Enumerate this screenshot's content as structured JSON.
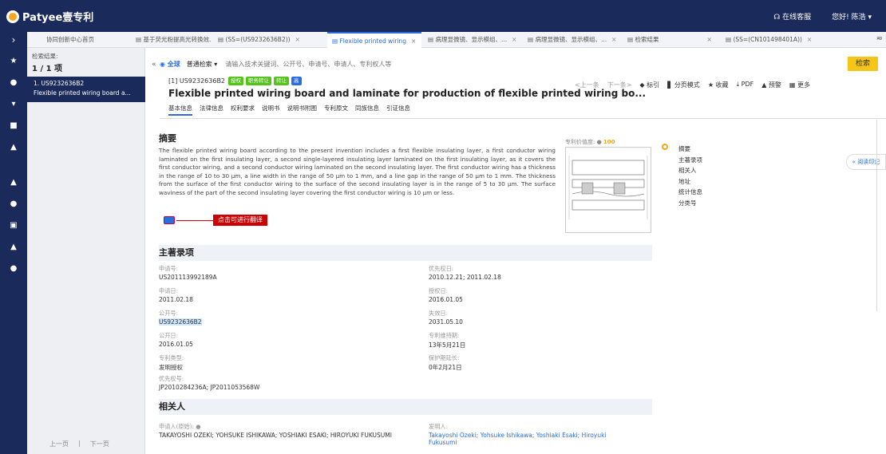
{
  "app": {
    "logo": "Patyee壹专利",
    "online_service": "在线客服",
    "greeting": "您好! 陈浩 ▾"
  },
  "tabs": [
    {
      "label": "协同创新中心首页"
    },
    {
      "label": "基于荧光粉提高光转换效..."
    },
    {
      "label": "(SS=(US9232636B2))"
    },
    {
      "label": "Flexible printed wiring"
    },
    {
      "label": "病理显微镜、显示模组、..."
    },
    {
      "label": "病理显微镜、显示模组、..."
    },
    {
      "label": "检索结果"
    },
    {
      "label": "(SS=(CN101498401A))"
    }
  ],
  "results": {
    "label": "检索结果:",
    "count": "1 / 1 项",
    "item_no": "1. US9232636B2",
    "item_title": "Flexible printed wiring board a...",
    "prev": "上一页",
    "sep": "|",
    "next": "下一页"
  },
  "search": {
    "scope": "全球",
    "type": "普通检索 ▾",
    "placeholder": "请输入技术关键词、公开号、申请号、申请人、专利权人等",
    "button": "检索"
  },
  "patent": {
    "num": "[1] US9232636B2",
    "badges": [
      {
        "text": "授权",
        "color": "#52c41a"
      },
      {
        "text": "职务转让",
        "color": "#52c41a"
      },
      {
        "text": "转让",
        "color": "#52c41a"
      },
      {
        "text": "高",
        "color": "#2a6de0"
      }
    ],
    "title": "Flexible printed wiring board and laminate for production of flexible printed wiring bo...",
    "toolbar": [
      "<上一条",
      "下一条>",
      "标引",
      "分页模式",
      "收藏",
      "PDF",
      "预警",
      "更多"
    ],
    "subtabs": [
      "基本信息",
      "法律信息",
      "权利要求",
      "说明书",
      "说明书附图",
      "专利原文",
      "同族信息",
      "引证信息"
    ]
  },
  "abstract": {
    "heading": "摘要",
    "text": "The flexible printed wiring board according to the present invention includes a first flexible insulating layer, a first conductor wiring laminated on the first insulating layer, a second single-layered insulating layer laminated on the first insulating layer, as it covers the first conductor wiring, and a second conductor wiring laminated on the second insulating layer. The first conductor wiring has a thickness in the range of 10 to 30 μm, a line width in the range of 50 μm to 1 mm, and a line gap in the range of 50 μm to 1 mm. The thickness from the surface of the first conductor wiring to the surface of the second insulating layer is in the range of 5 to 30 μm. The surface waviness of the part of the second insulating layer covering the first conductor wiring is 10 μm or less.",
    "translate_tip": "点击可进行翻译",
    "value_label": "专利价值度:",
    "value": "100"
  },
  "outline": [
    "摘要",
    "主著录项",
    "相关人",
    "地址",
    "统计信息",
    "分类号"
  ],
  "read_mark": "阅读印记",
  "biblio": {
    "heading": "主著录项",
    "fields": [
      {
        "label": "申请号:",
        "value": "US201113992189A"
      },
      {
        "label": "优先权日:",
        "value": "2010.12.21; 2011.02.18"
      },
      {
        "label": "申请日:",
        "value": "2011.02.18"
      },
      {
        "label": "授权日:",
        "value": "2016.01.05"
      },
      {
        "label": "公开号:",
        "value": "US9232636B2"
      },
      {
        "label": "失效日:",
        "value": "2031.05.10"
      },
      {
        "label": "公开日:",
        "value": "2016.01.05"
      },
      {
        "label": "专利维持期:",
        "value": "13年5月21日"
      },
      {
        "label": "专利类型:",
        "value": "发明授权"
      },
      {
        "label": "保护期延长:",
        "value": "0年2月21日"
      },
      {
        "label": "优先权号:",
        "value": "JP2010284236A; JP2011053568W"
      }
    ]
  },
  "related": {
    "heading": "相关人",
    "applicant_label": "申请人(原始):",
    "applicant": "TAKAYOSHI OZEKI; YOHSUKE ISHIKAWA; YOSHIAKI ESAKI; HIROYUKI FUKUSUMI",
    "inventor_label": "发明人:",
    "inventor": "Takayoshi Ozeki; Yohsuke Ishikawa; Yoshiaki Esaki; Hiroyuki Fukusumi"
  }
}
